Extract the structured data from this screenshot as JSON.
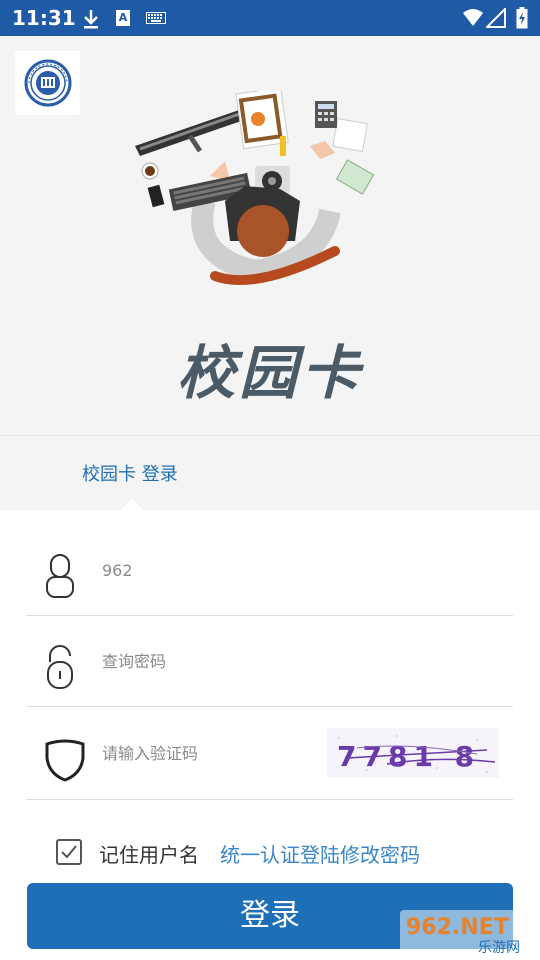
{
  "status_bar": {
    "time": "11:31",
    "icons": [
      "download-icon",
      "a-icon",
      "keyboard-icon",
      "wifi-icon",
      "signal-icon",
      "battery-icon"
    ],
    "a_glyph": "A",
    "color": "#1e5aa6"
  },
  "header": {
    "title": "校园卡",
    "logo": "university-seal-icon",
    "illustration": "desk-workspace-illustration"
  },
  "tab": {
    "label": "校园卡 登录",
    "color": "#1e6fb5"
  },
  "form": {
    "username": {
      "value": "",
      "placeholder": "962",
      "icon": "user-icon"
    },
    "password": {
      "value": "",
      "placeholder": "查询密码",
      "icon": "lock-icon"
    },
    "captcha": {
      "value": "",
      "placeholder": "请输入验证码",
      "icon": "shield-icon",
      "image_text": "7781 8"
    }
  },
  "remember": {
    "label": "记住用户名",
    "checked": false
  },
  "change_password_link": "统一认证登陆修改密码",
  "login_button": {
    "label": "登录",
    "color": "#1d70b8"
  },
  "watermark": {
    "top": "962.NET",
    "bottom": "乐游网"
  }
}
